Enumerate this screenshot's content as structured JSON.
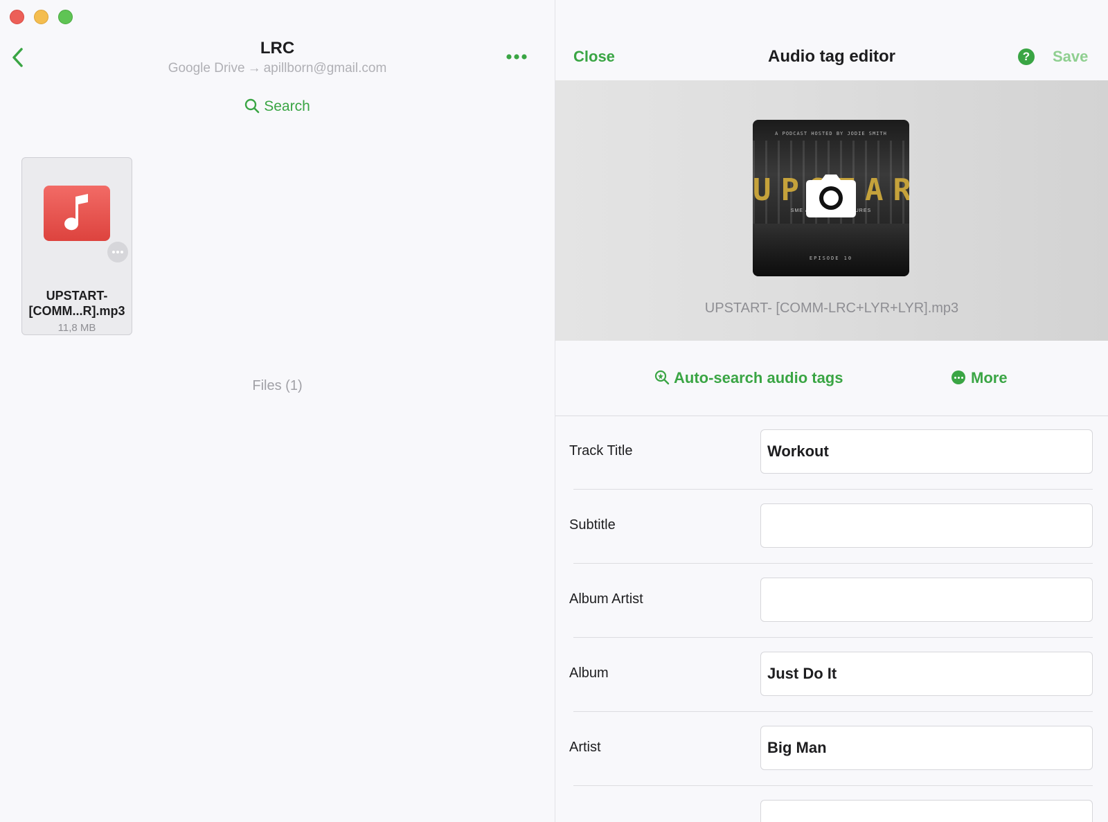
{
  "window": {
    "controls": [
      "close",
      "minimize",
      "zoom"
    ]
  },
  "browser": {
    "title": "LRC",
    "location": "Google Drive",
    "account": "apillborn@gmail.com",
    "search_label": "Search",
    "file": {
      "name": "UPSTART-\n[COMM...R].mp3",
      "size": "11,8 MB"
    },
    "files_count": "Files (1)"
  },
  "editor": {
    "close_label": "Close",
    "title": "Audio tag editor",
    "help_label": "?",
    "save_label": "Save",
    "cover": {
      "art_top": "A PODCAST HOSTED BY JODIE SMITH",
      "art_title": "UPSTART",
      "art_sub": "SME & STARTUP FEATURES",
      "art_episode": "EPISODE 10",
      "file_name": "UPSTART- [COMM-LRC+LYR+LYR].mp3"
    },
    "auto_search_label": "Auto-search audio tags",
    "more_label": "More",
    "fields": [
      {
        "label": "Track Title",
        "value": "Workout"
      },
      {
        "label": "Subtitle",
        "value": ""
      },
      {
        "label": "Album Artist",
        "value": ""
      },
      {
        "label": "Album",
        "value": "Just Do It"
      },
      {
        "label": "Artist",
        "value": "Big Man"
      },
      {
        "label": "",
        "value": ""
      }
    ]
  },
  "colors": {
    "accent": "#3aa544",
    "save_disabled": "#8fcf90",
    "music_icon": "#e4524c"
  }
}
